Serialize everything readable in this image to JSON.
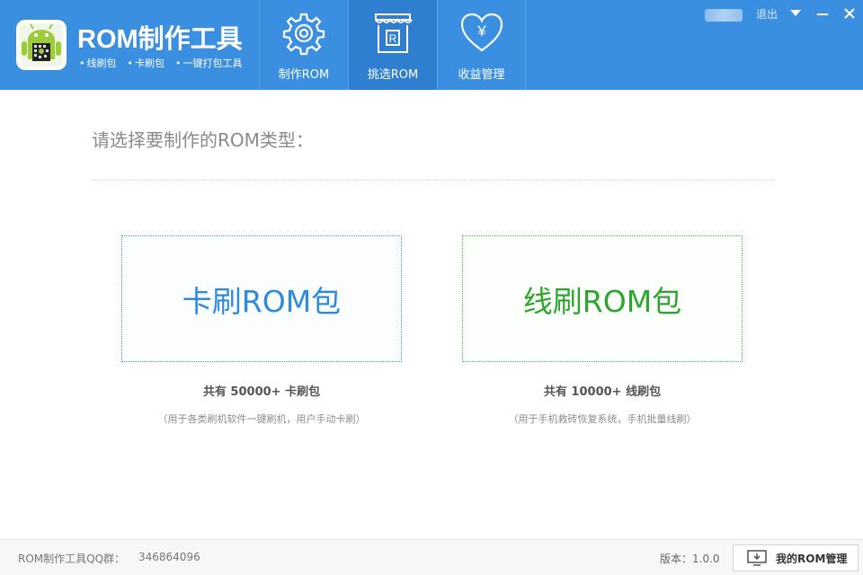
{
  "header": {
    "title": "ROM制作工具",
    "features": [
      "线刷包",
      "卡刷包",
      "一键打包工具"
    ],
    "logout": "退出",
    "colors": {
      "background": "#3b8fe0",
      "active_tab": "#2f7fd0"
    }
  },
  "nav": [
    {
      "label": "制作ROM",
      "icon": "gear-icon",
      "active": false
    },
    {
      "label": "挑选ROM",
      "icon": "store-icon",
      "active": true
    },
    {
      "label": "收益管理",
      "icon": "heart-yen-icon",
      "active": false
    }
  ],
  "main": {
    "prompt": "请选择要制作的ROM类型：",
    "cards": [
      {
        "title": "卡刷ROM包",
        "count": "共有 50000+ 卡刷包",
        "desc": "（用于各类刷机软件一键刷机，用户手动卡刷）",
        "color": "#2c8be0"
      },
      {
        "title": "线刷ROM包",
        "count": "共有 10000+ 线刷包",
        "desc": "（用于手机救砖恢复系统，手机批量线刷）",
        "color": "#2ea52e"
      }
    ]
  },
  "footer": {
    "qq_label": "ROM制作工具QQ群：",
    "qq_number": "346864096",
    "version": "版本：1.0.0",
    "my_rom_button": "我的ROM管理"
  }
}
